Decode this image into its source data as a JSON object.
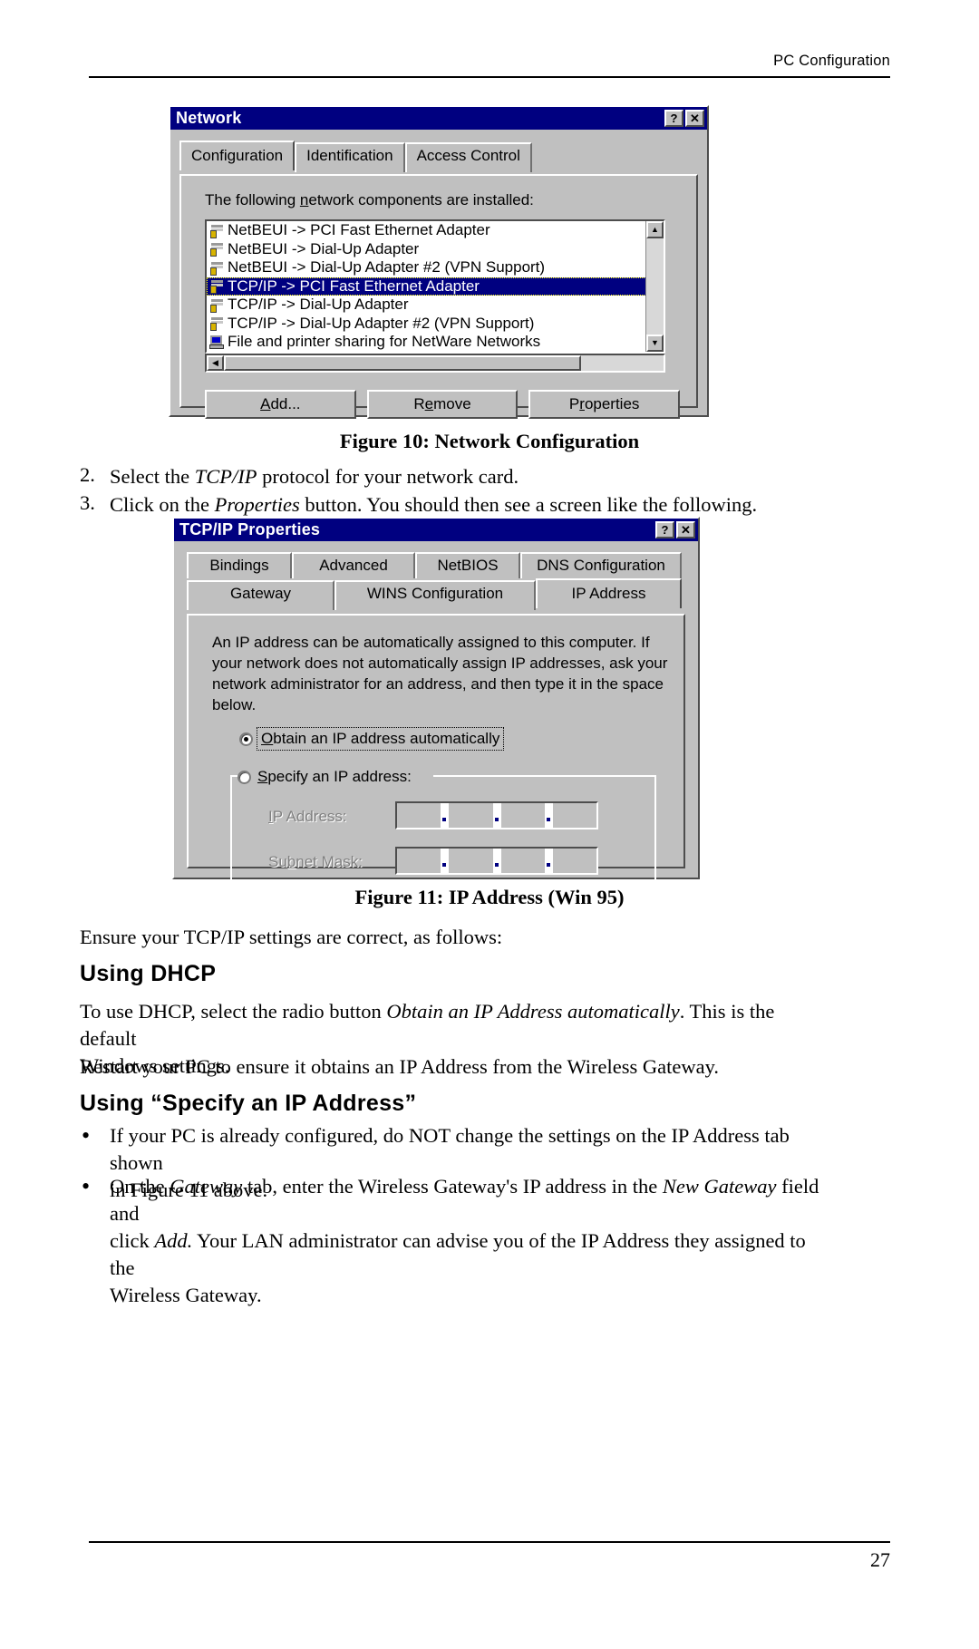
{
  "header": {
    "running_head": "PC Configuration"
  },
  "footer": {
    "page_number": "27"
  },
  "figure10": {
    "window_title": "Network",
    "help_button": "?",
    "close_button": "✕",
    "tabs": [
      "Configuration",
      "Identification",
      "Access Control"
    ],
    "selected_tab": "Configuration",
    "list_label_pre": "The following ",
    "list_label_mn": "n",
    "list_label_post": "etwork components are installed:",
    "components": [
      {
        "label": "NetBEUI -> PCI Fast Ethernet Adapter",
        "icon": "protocol-icon",
        "selected": false
      },
      {
        "label": "NetBEUI -> Dial-Up Adapter",
        "icon": "protocol-icon",
        "selected": false
      },
      {
        "label": "NetBEUI -> Dial-Up Adapter #2 (VPN Support)",
        "icon": "protocol-icon",
        "selected": false
      },
      {
        "label": "TCP/IP -> PCI Fast Ethernet Adapter",
        "icon": "protocol-icon",
        "selected": true
      },
      {
        "label": "TCP/IP -> Dial-Up Adapter",
        "icon": "protocol-icon",
        "selected": false
      },
      {
        "label": "TCP/IP -> Dial-Up Adapter #2 (VPN Support)",
        "icon": "protocol-icon",
        "selected": false
      },
      {
        "label": "File and printer sharing for NetWare Networks",
        "icon": "computer-icon",
        "selected": false
      }
    ],
    "buttons": {
      "add": {
        "pre": "",
        "mn": "A",
        "post": "dd..."
      },
      "remove": {
        "pre": "R",
        "mn": "e",
        "post": "move"
      },
      "properties": {
        "pre": "P",
        "mn": "r",
        "post": "operties"
      }
    },
    "caption": "Figure 10: Network Configuration"
  },
  "step2": {
    "number": "2.",
    "pre": "Select the ",
    "em": "TCP/IP",
    "post": " protocol for your network card."
  },
  "step3": {
    "number": "3.",
    "pre": "Click on the ",
    "em": "Properties",
    "post": " button.  You should then see a screen like the following."
  },
  "figure11": {
    "window_title": "TCP/IP Properties",
    "help_button": "?",
    "close_button": "✕",
    "tabs_row1": [
      "Bindings",
      "Advanced",
      "NetBIOS",
      "DNS Configuration"
    ],
    "tabs_row2": [
      "Gateway",
      "WINS Configuration",
      "IP Address"
    ],
    "selected_tab": "IP Address",
    "description_lines": [
      "An IP address can be automatically assigned to this computer.  If",
      "your network does not automatically assign IP addresses, ask your",
      "network administrator for an address, and then type it in the space",
      "below."
    ],
    "radio_auto": {
      "mn": "O",
      "post": "btain an IP address automatically",
      "checked": true
    },
    "radio_specify": {
      "mn": "S",
      "post": "pecify an IP address:",
      "checked": false
    },
    "ip_address_label": {
      "mn": "I",
      "post": "P Address:"
    },
    "subnet_mask_label": {
      "pre": "Su",
      "mn": "b",
      "post": "net Mask:"
    },
    "ip_address_value": [
      "",
      "",
      "",
      ""
    ],
    "subnet_mask_value": [
      "",
      "",
      "",
      ""
    ],
    "caption": "Figure 11: IP Address (Win 95)"
  },
  "after_fig11": "Ensure your TCP/IP settings are correct, as follows:",
  "section_dhcp": {
    "heading": "Using DHCP",
    "p1_pre": "To use DHCP, select the radio button ",
    "p1_em": "Obtain an IP Address automatically",
    "p1_post": ". This is the default",
    "p1_line2": "Windows settings.",
    "p2": "Restart your PC to ensure it obtains an IP Address from the Wireless Gateway."
  },
  "section_specify": {
    "heading": "Using “Specify an IP Address”",
    "bullets": [
      {
        "glyph": "•",
        "line1": "If your PC is already configured, do NOT change the settings on the IP Address tab shown",
        "line2": "in Figure 11 above."
      },
      {
        "glyph": "•",
        "l1_pre": "On the ",
        "l1_em1": "Gateway",
        "l1_mid": " tab, enter the Wireless Gateway's IP address in the ",
        "l1_em2": "New Gateway",
        "l1_post": " field and",
        "l2_pre": "click ",
        "l2_em": "Add.",
        "l2_post": " Your LAN administrator can advise you of the IP Address they assigned to the",
        "l3": "Wireless Gateway."
      }
    ]
  },
  "colors": {
    "titlebar": "#000080",
    "dialog_face": "#c0c0c0",
    "selection": "#000080",
    "disabled_text": "#808080"
  }
}
